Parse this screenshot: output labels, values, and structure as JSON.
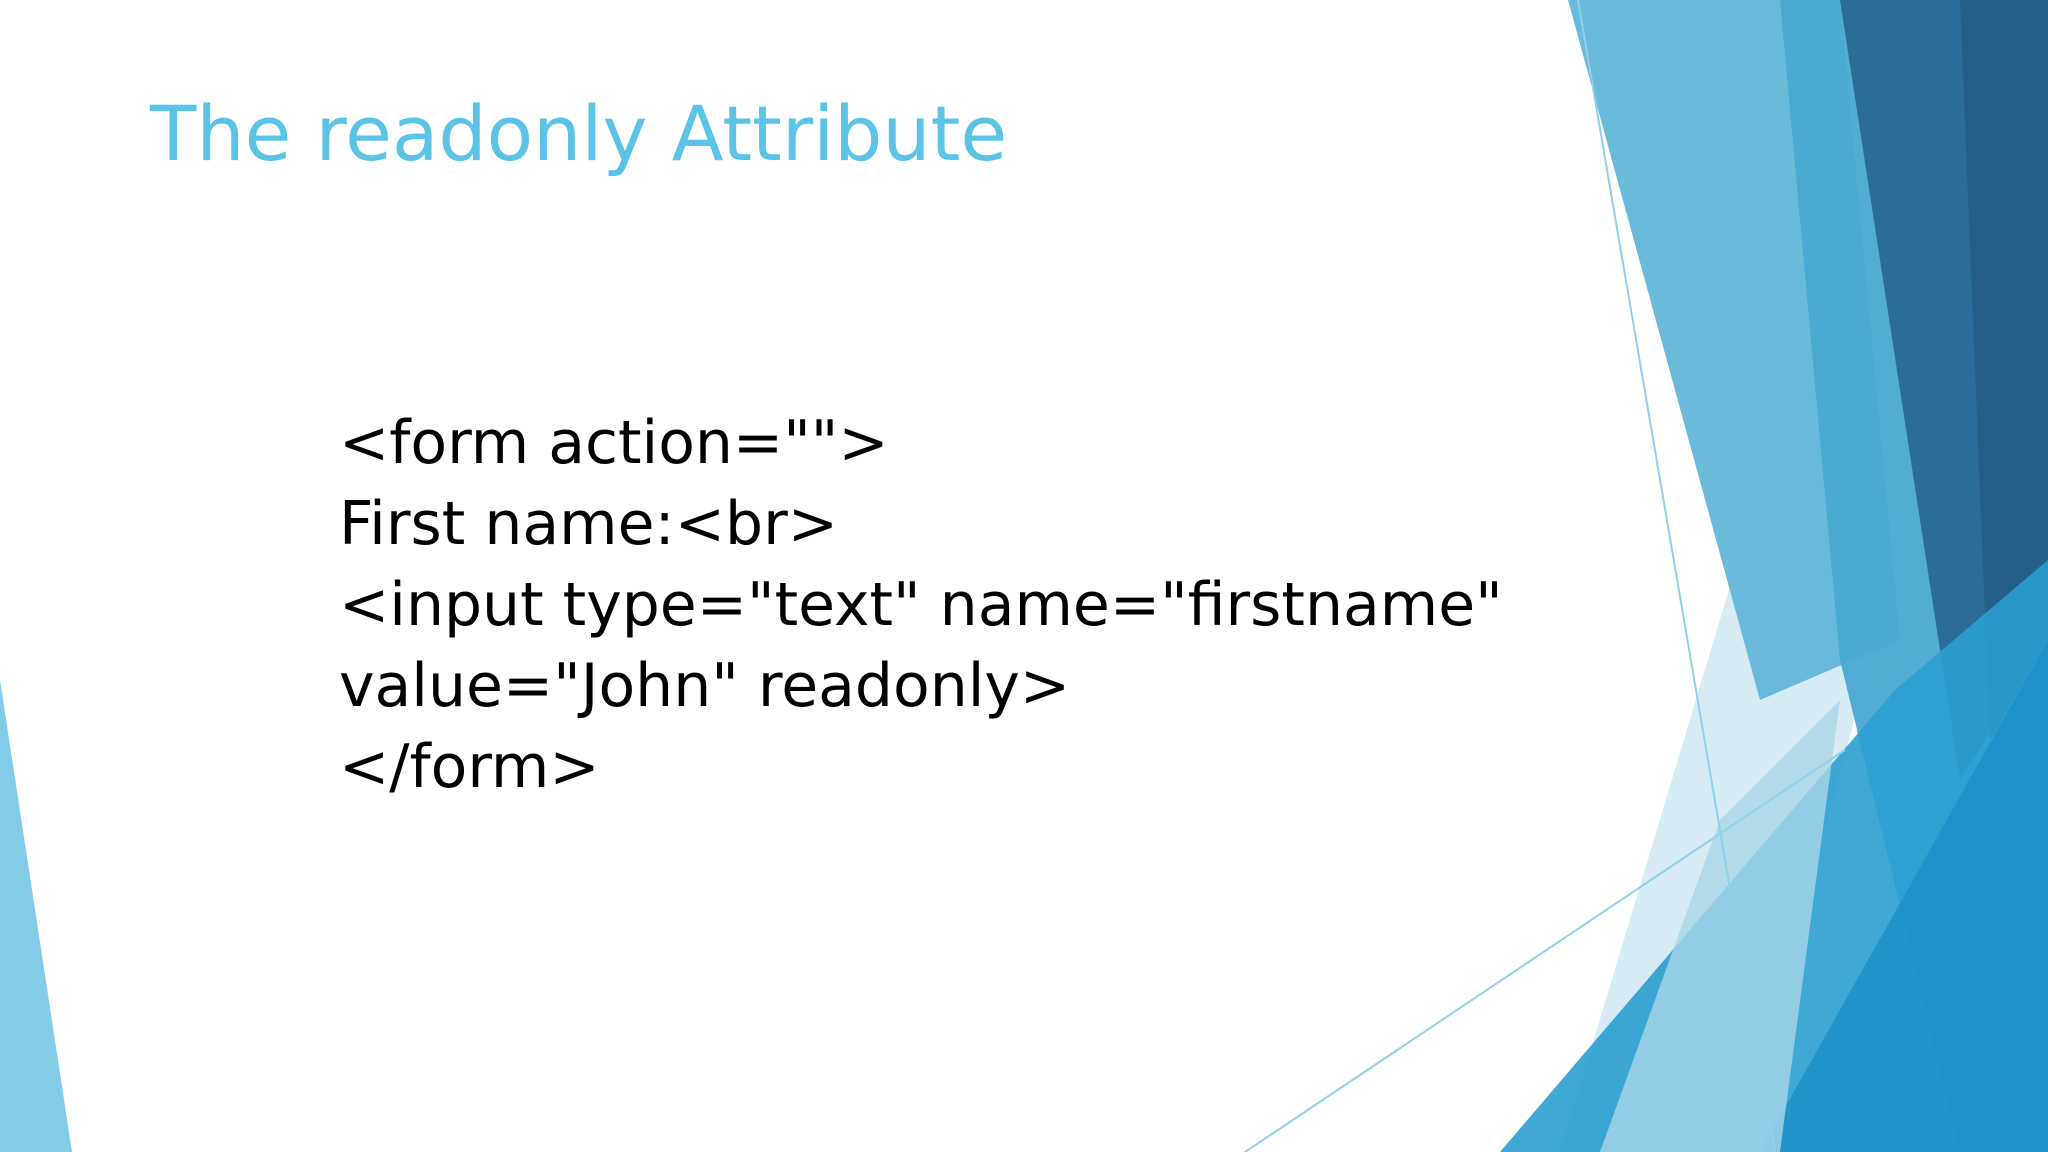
{
  "slide": {
    "title": "The readonly Attribute",
    "code_lines": [
      "<form action=\"\">",
      "First name:<br>",
      "<input type=\"text\" name=\"firstname\"",
      "value=\"John\" readonly>",
      "</form>"
    ]
  },
  "theme": {
    "title_color": "#5bc3e6",
    "text_color": "#000000",
    "accent_light": "#9fd3e6",
    "accent_mid": "#5bb7d9",
    "accent_deep": "#2f82b0",
    "accent_dark": "#245f88"
  }
}
